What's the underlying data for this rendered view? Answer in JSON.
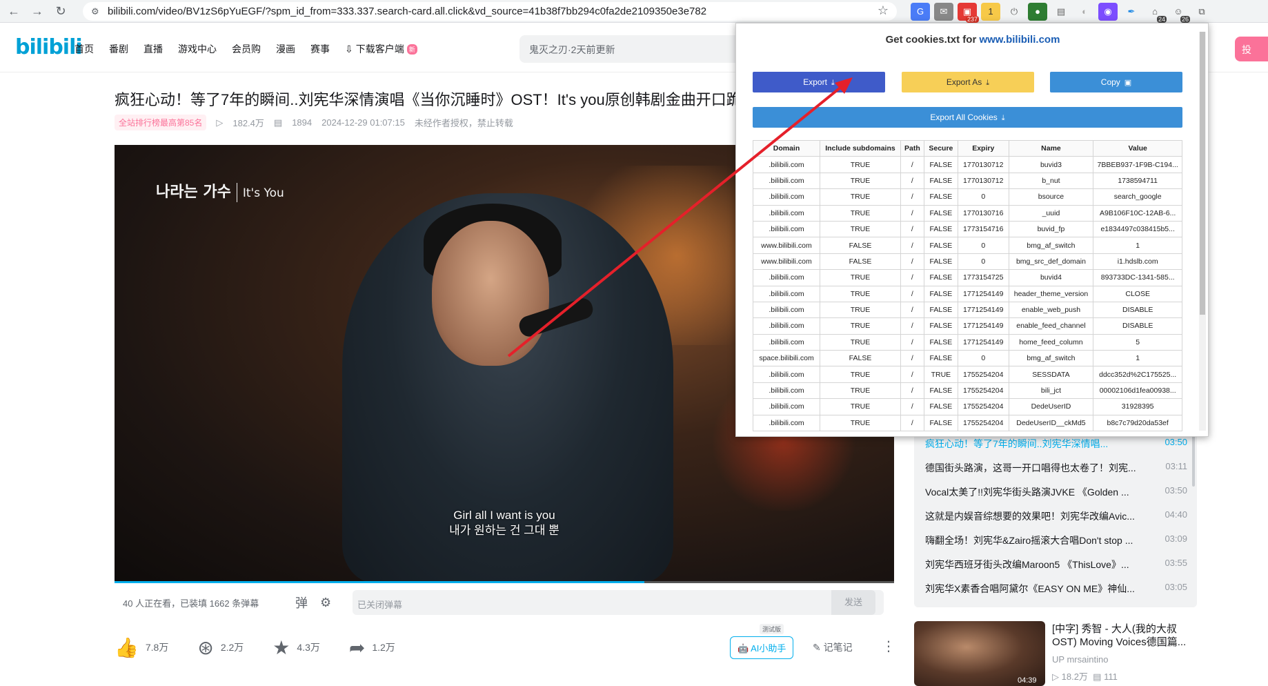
{
  "browser": {
    "url": "bilibili.com/video/BV1zS6pYuEGF/?spm_id_from=333.337.search-card.all.click&vd_source=41b38f7bb294c0fa2de2109350e3e782",
    "ext_badge_mail": "237",
    "ext_badge_1": "24",
    "ext_badge_2": "26",
    "colors": {
      "chrome_bg": "#f1f3f4",
      "badge": "#d93025"
    }
  },
  "header": {
    "logo": "bilibili",
    "nav": [
      "首页",
      "番剧",
      "直播",
      "游戏中心",
      "会员购",
      "漫画",
      "赛事",
      "下载客户端"
    ],
    "new_badge": "新",
    "search_placeholder": "鬼灭之刃·2天前更新",
    "upload_label": "投",
    "colors": {
      "brand": "#00a1d6",
      "pink": "#fb7299"
    }
  },
  "video": {
    "title": "疯狂心动！等了7年的瞬间..刘宪华深情演唱《当你沉睡时》OST！It's you原创韩剧金曲开口跪",
    "rank": "全站排行榜最高第85名",
    "views": "182.4万",
    "danmaku_count": "1894",
    "date": "2024-12-29 01:07:15",
    "copyright": "未经作者授权，禁止转载",
    "show_logo_ko": "나라는 가수",
    "show_logo_en": "It's You",
    "subtitle_en": "Girl all I want is you",
    "subtitle_ko": "내가 원하는 건 그대 뿐",
    "progress_fraction": 0.68,
    "viewers_text": "40 人正在看，已装填 1662 条弹幕",
    "danmaku_placeholder": "已关闭弹幕",
    "send_label": "发送"
  },
  "actions": {
    "like": "7.8万",
    "coin": "2.2万",
    "fav": "4.3万",
    "share": "1.2万",
    "ai_label": "AI小助手",
    "ai_test": "测试版",
    "note_label": "记笔记"
  },
  "playlist": [
    {
      "title": "疯狂心动！等了7年的瞬间..刘宪华深情唱...",
      "dur": "03:50",
      "active": true
    },
    {
      "title": "德国街头路演，这哥一开口唱得也太卷了！刘宪...",
      "dur": "03:11"
    },
    {
      "title": "Vocal太美了!!刘宪华街头路演JVKE 《Golden ...",
      "dur": "03:50"
    },
    {
      "title": "这就是内娱音综想要的效果吧！刘宪华改编Avic...",
      "dur": "04:40"
    },
    {
      "title": "嗨翻全场！刘宪华&Zairo摇滚大合唱Don't stop ...",
      "dur": "03:09"
    },
    {
      "title": "刘宪华西班牙街头改编Maroon5 《ThisLove》...",
      "dur": "03:55"
    },
    {
      "title": "刘宪华X素香合唱阿黛尔《EASY ON ME》神仙...",
      "dur": "03:05"
    }
  ],
  "recommend": {
    "title": "[中字] 秀智 - 大人(我的大叔 OST) Moving Voices德国篇...",
    "up": "mrsaintino",
    "views": "18.2万",
    "comments": "111",
    "dur": "04:39"
  },
  "popup": {
    "title_prefix": "Get cookies.txt for ",
    "title_link": "www.bilibili.com",
    "btn_export": "Export",
    "btn_export_as": "Export As",
    "btn_copy": "Copy",
    "btn_export_all": "Export All Cookies",
    "columns": [
      "Domain",
      "Include subdomains",
      "Path",
      "Secure",
      "Expiry",
      "Name",
      "Value"
    ],
    "rows": [
      [
        ".bilibili.com",
        "TRUE",
        "/",
        "FALSE",
        "1770130712",
        "buvid3",
        "7BBEB937-1F9B-C194..."
      ],
      [
        ".bilibili.com",
        "TRUE",
        "/",
        "FALSE",
        "1770130712",
        "b_nut",
        "1738594711"
      ],
      [
        ".bilibili.com",
        "TRUE",
        "/",
        "FALSE",
        "0",
        "bsource",
        "search_google"
      ],
      [
        ".bilibili.com",
        "TRUE",
        "/",
        "FALSE",
        "1770130716",
        "_uuid",
        "A9B106F10C-12AB-6..."
      ],
      [
        ".bilibili.com",
        "TRUE",
        "/",
        "FALSE",
        "1773154716",
        "buvid_fp",
        "e1834497c038415b5..."
      ],
      [
        "www.bilibili.com",
        "FALSE",
        "/",
        "FALSE",
        "0",
        "bmg_af_switch",
        "1"
      ],
      [
        "www.bilibili.com",
        "FALSE",
        "/",
        "FALSE",
        "0",
        "bmg_src_def_domain",
        "i1.hdslb.com"
      ],
      [
        ".bilibili.com",
        "TRUE",
        "/",
        "FALSE",
        "1773154725",
        "buvid4",
        "893733DC-1341-585..."
      ],
      [
        ".bilibili.com",
        "TRUE",
        "/",
        "FALSE",
        "1771254149",
        "header_theme_version",
        "CLOSE"
      ],
      [
        ".bilibili.com",
        "TRUE",
        "/",
        "FALSE",
        "1771254149",
        "enable_web_push",
        "DISABLE"
      ],
      [
        ".bilibili.com",
        "TRUE",
        "/",
        "FALSE",
        "1771254149",
        "enable_feed_channel",
        "DISABLE"
      ],
      [
        ".bilibili.com",
        "TRUE",
        "/",
        "FALSE",
        "1771254149",
        "home_feed_column",
        "5"
      ],
      [
        "space.bilibili.com",
        "FALSE",
        "/",
        "FALSE",
        "0",
        "bmg_af_switch",
        "1"
      ],
      [
        ".bilibili.com",
        "TRUE",
        "/",
        "TRUE",
        "1755254204",
        "SESSDATA",
        "ddcc352d%2C175525..."
      ],
      [
        ".bilibili.com",
        "TRUE",
        "/",
        "FALSE",
        "1755254204",
        "bili_jct",
        "00002106d1fea00938..."
      ],
      [
        ".bilibili.com",
        "TRUE",
        "/",
        "FALSE",
        "1755254204",
        "DedeUserID",
        "31928395"
      ],
      [
        ".bilibili.com",
        "TRUE",
        "/",
        "FALSE",
        "1755254204",
        "DedeUserID__ckMd5",
        "b8c7c79d20da53ef"
      ]
    ],
    "colors": {
      "export": "#3f5bc9",
      "export_as": "#f7cf57",
      "copy": "#3b8fd7",
      "arrow": "#e5202a"
    }
  }
}
